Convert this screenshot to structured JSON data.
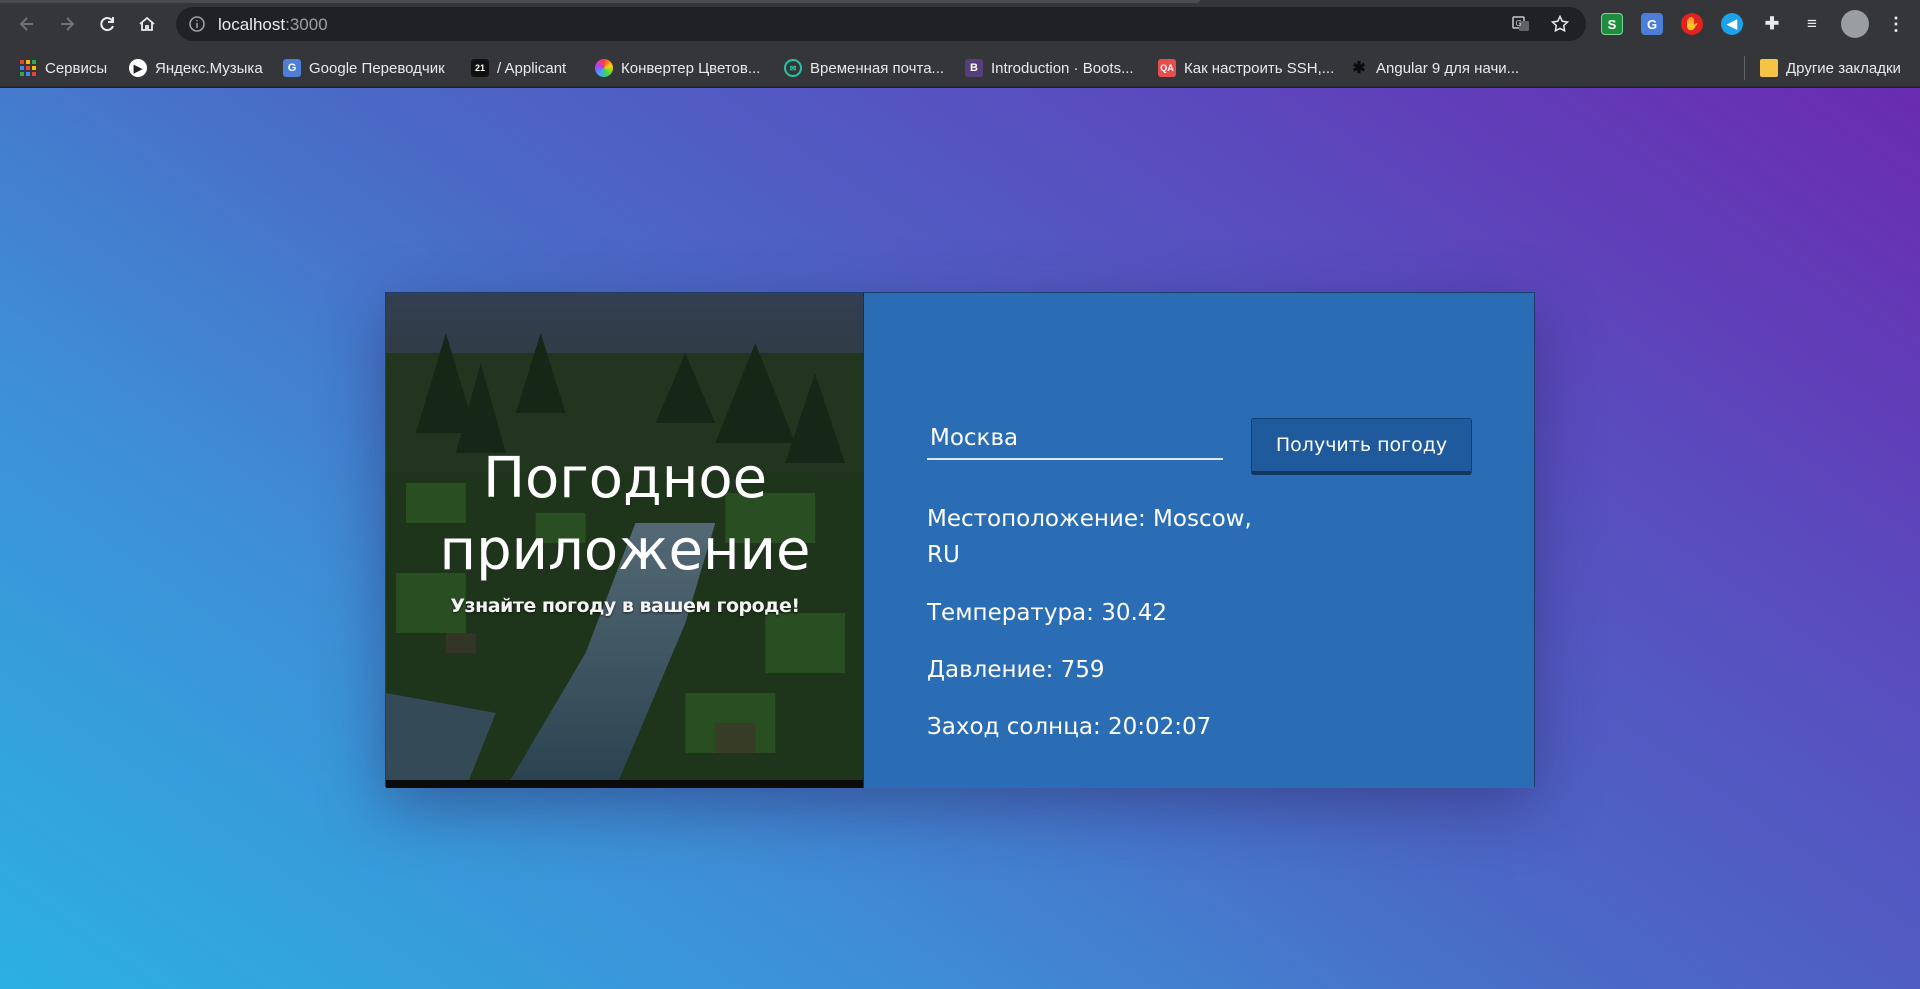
{
  "browser": {
    "url_host": "localhost",
    "url_port": ":3000",
    "bookmarks": [
      {
        "label": "Сервисы",
        "icon": "apps-grid-icon"
      },
      {
        "label": "Яндекс.Музыка",
        "icon": "yandex-music-icon"
      },
      {
        "label": "Google Переводчик",
        "icon": "google-translate-icon"
      },
      {
        "label": "/ Applicant",
        "icon": "applicant-icon"
      },
      {
        "label": "Конвертер Цветов...",
        "icon": "color-wheel-icon"
      },
      {
        "label": "Временная почта...",
        "icon": "temp-mail-icon"
      },
      {
        "label": "Introduction · Boots...",
        "icon": "bootstrap-icon"
      },
      {
        "label": "Как настроить SSH,...",
        "icon": "qa-icon"
      },
      {
        "label": "Angular 9 для начи...",
        "icon": "bug-icon"
      }
    ],
    "other_bookmarks": "Другие закладки",
    "extensions": [
      "sheets-icon",
      "translate-icon",
      "adblock-icon",
      "audio-icon",
      "puzzle-icon",
      "playlist-icon",
      "profile-avatar-icon",
      "menu-dots-icon"
    ]
  },
  "app": {
    "title_line1": "Погодное",
    "title_line2": "приложение",
    "subtitle": "Узнайте погоду в вашем городе!",
    "city_value": "Москва",
    "button_label": "Получить погоду",
    "location_line1": "Местоположение: Moscow,",
    "location_line2": "RU",
    "temperature": "Температура: 30.42",
    "pressure": "Давление: 759",
    "sunset": "Заход солнца: 20:02:07"
  },
  "colors": {
    "gradient_start": "#6a2bb0",
    "gradient_end": "#2cb0e2",
    "panel": "#2a6db5",
    "button": "#1f5a9d"
  }
}
